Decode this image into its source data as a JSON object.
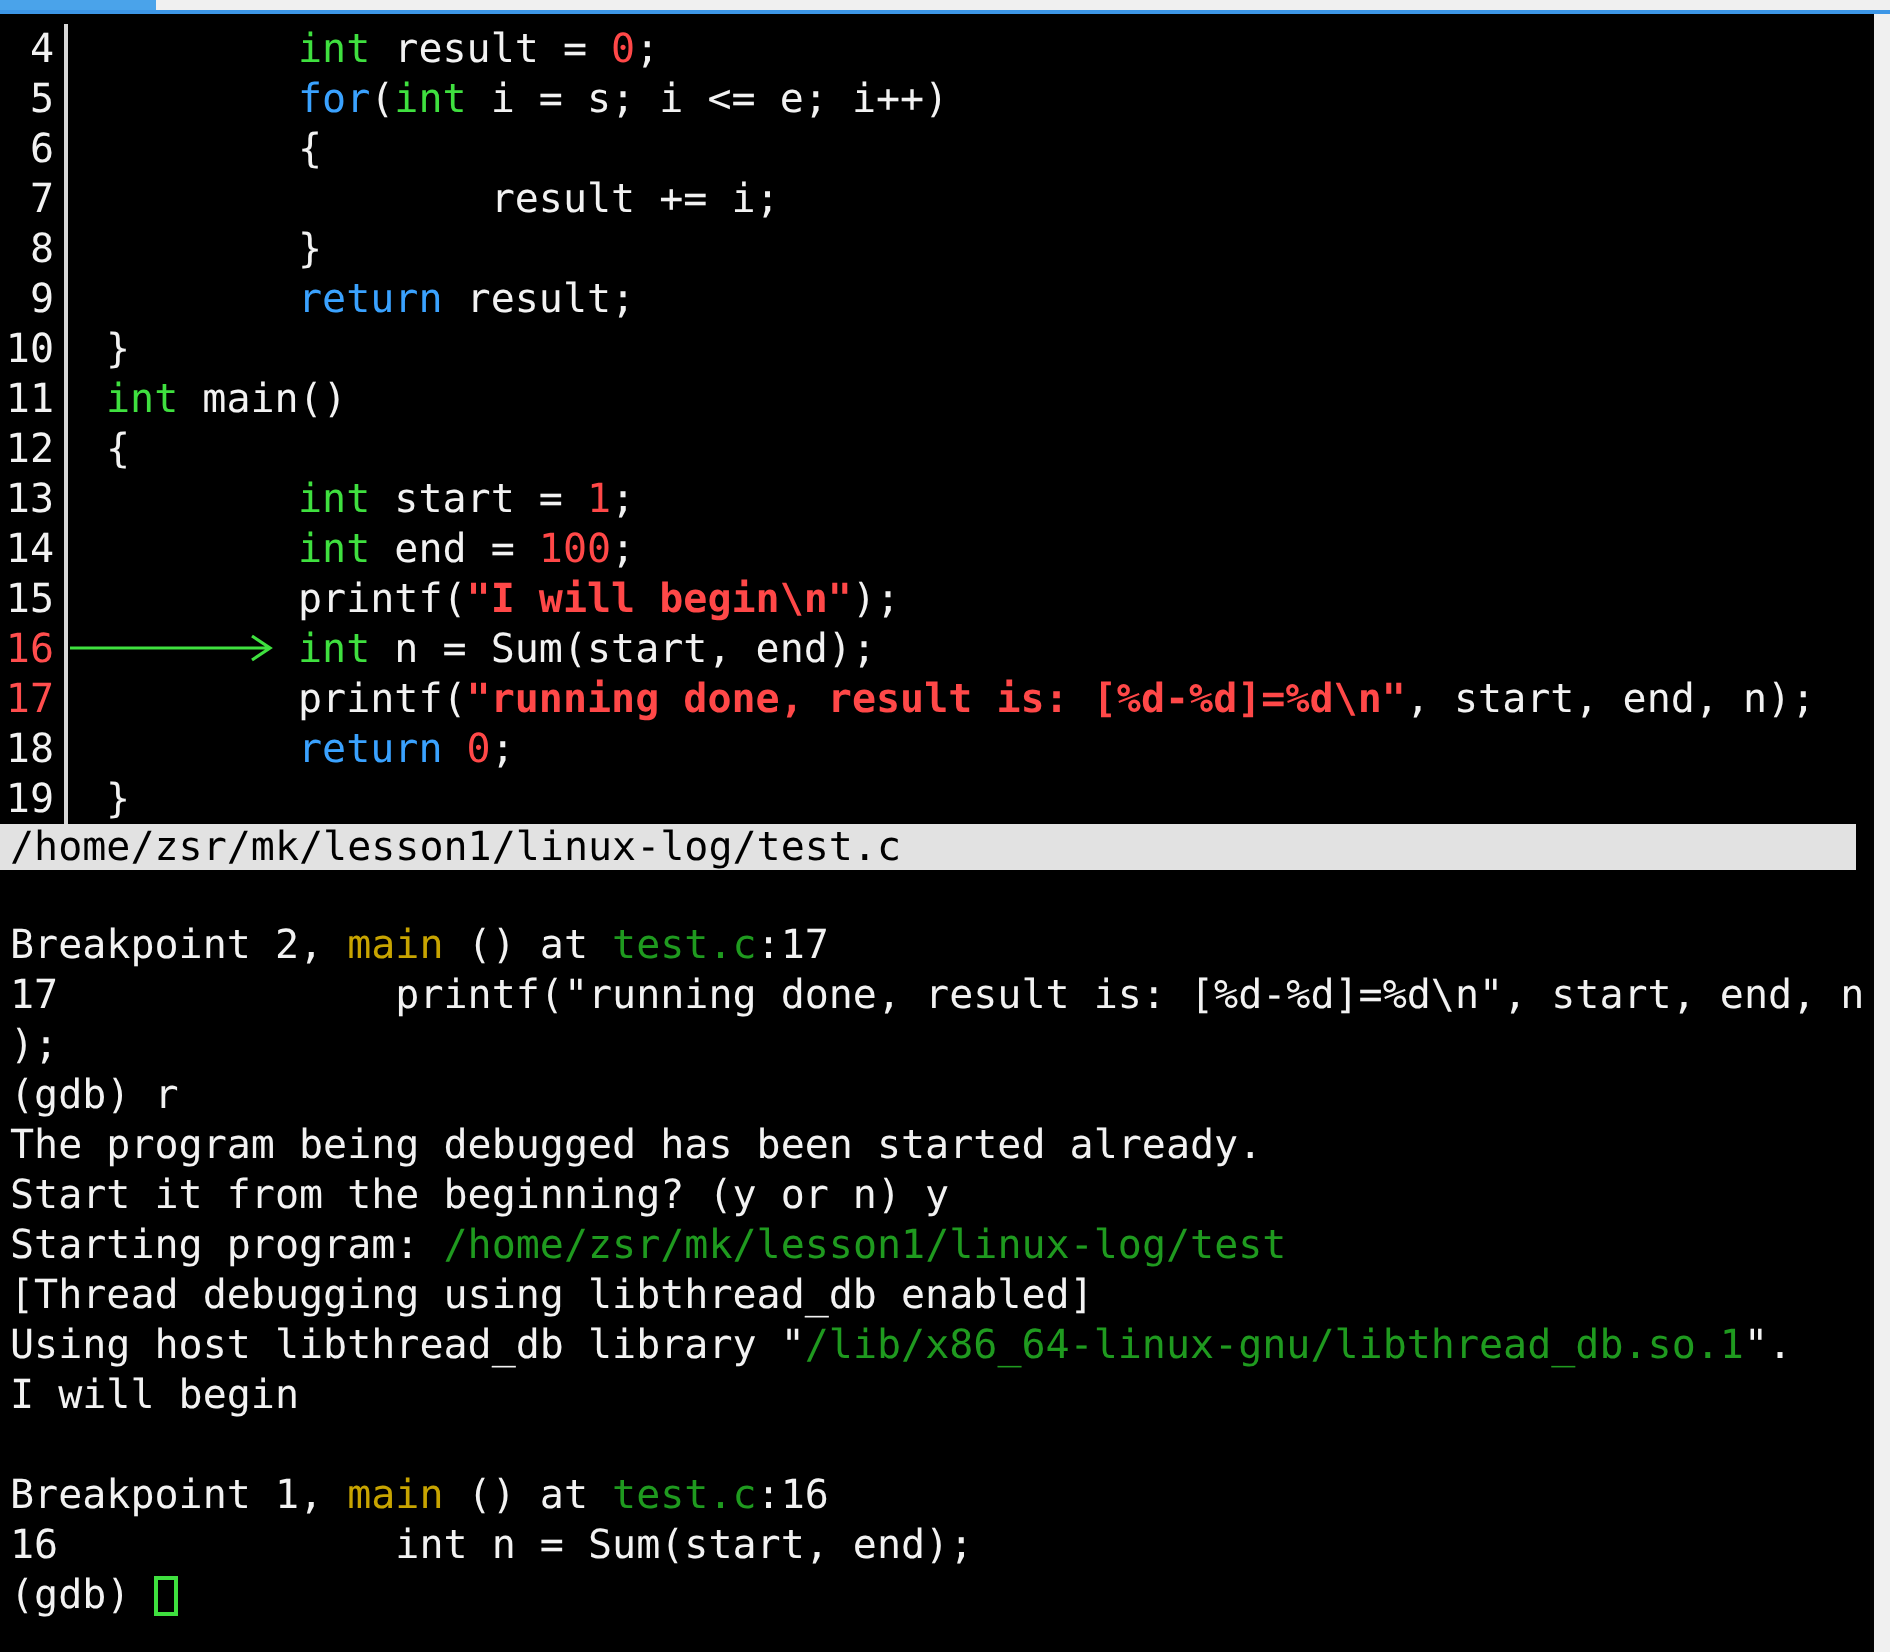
{
  "source": {
    "lines": [
      {
        "number": "4",
        "indented": true,
        "breakpoint": false,
        "current": false,
        "tokens": [
          {
            "text": "int",
            "kind": "type"
          },
          {
            "text": " result = ",
            "kind": "plain"
          },
          {
            "text": "0",
            "kind": "number"
          },
          {
            "text": ";",
            "kind": "plain"
          }
        ]
      },
      {
        "number": "5",
        "indented": true,
        "breakpoint": false,
        "current": false,
        "tokens": [
          {
            "text": "for",
            "kind": "keyword"
          },
          {
            "text": "(",
            "kind": "plain"
          },
          {
            "text": "int",
            "kind": "type"
          },
          {
            "text": " i = s; i <= e; i++)",
            "kind": "plain"
          }
        ]
      },
      {
        "number": "6",
        "indented": true,
        "breakpoint": false,
        "current": false,
        "tokens": [
          {
            "text": "{",
            "kind": "plain"
          }
        ]
      },
      {
        "number": "7",
        "indented": true,
        "breakpoint": false,
        "current": false,
        "tokens": [
          {
            "text": "\tresult += i;",
            "kind": "plain"
          }
        ]
      },
      {
        "number": "8",
        "indented": true,
        "breakpoint": false,
        "current": false,
        "tokens": [
          {
            "text": "}",
            "kind": "plain"
          }
        ]
      },
      {
        "number": "9",
        "indented": true,
        "breakpoint": false,
        "current": false,
        "tokens": [
          {
            "text": "return",
            "kind": "keyword"
          },
          {
            "text": " result;",
            "kind": "plain"
          }
        ]
      },
      {
        "number": "10",
        "indented": false,
        "breakpoint": false,
        "current": false,
        "tokens": [
          {
            "text": "}",
            "kind": "plain"
          }
        ]
      },
      {
        "number": "11",
        "indented": false,
        "breakpoint": false,
        "current": false,
        "tokens": [
          {
            "text": "int",
            "kind": "type"
          },
          {
            "text": " main()",
            "kind": "plain"
          }
        ]
      },
      {
        "number": "12",
        "indented": false,
        "breakpoint": false,
        "current": false,
        "tokens": [
          {
            "text": "{",
            "kind": "plain"
          }
        ]
      },
      {
        "number": "13",
        "indented": true,
        "breakpoint": false,
        "current": false,
        "tokens": [
          {
            "text": "int",
            "kind": "type"
          },
          {
            "text": " start = ",
            "kind": "plain"
          },
          {
            "text": "1",
            "kind": "number"
          },
          {
            "text": ";",
            "kind": "plain"
          }
        ]
      },
      {
        "number": "14",
        "indented": true,
        "breakpoint": false,
        "current": false,
        "tokens": [
          {
            "text": "int",
            "kind": "type"
          },
          {
            "text": " end = ",
            "kind": "plain"
          },
          {
            "text": "100",
            "kind": "number"
          },
          {
            "text": ";",
            "kind": "plain"
          }
        ]
      },
      {
        "number": "15",
        "indented": true,
        "breakpoint": false,
        "current": false,
        "tokens": [
          {
            "text": "printf(",
            "kind": "plain"
          },
          {
            "text": "\"I will begin\\n\"",
            "kind": "string"
          },
          {
            "text": ");",
            "kind": "plain"
          }
        ]
      },
      {
        "number": "16",
        "indented": true,
        "breakpoint": true,
        "current": true,
        "tokens": [
          {
            "text": "int",
            "kind": "type"
          },
          {
            "text": " n = Sum(start, end);",
            "kind": "plain"
          }
        ]
      },
      {
        "number": "17",
        "indented": true,
        "breakpoint": true,
        "current": false,
        "tokens": [
          {
            "text": "printf(",
            "kind": "plain"
          },
          {
            "text": "\"running done, result is: [%d-%d]=%d\\n\"",
            "kind": "string"
          },
          {
            "text": ", start, end, n);",
            "kind": "plain"
          }
        ]
      },
      {
        "number": "18",
        "indented": true,
        "breakpoint": false,
        "current": false,
        "tokens": [
          {
            "text": "return",
            "kind": "keyword"
          },
          {
            "text": " 0",
            "kind": "number"
          },
          {
            "text": ";",
            "kind": "plain"
          }
        ]
      },
      {
        "number": "19",
        "indented": false,
        "breakpoint": false,
        "current": false,
        "tokens": [
          {
            "text": "}",
            "kind": "plain"
          }
        ]
      }
    ]
  },
  "status_bar": {
    "path": "/home/zsr/mk/lesson1/linux-log/test.c"
  },
  "console": {
    "lines": [
      {
        "gap_before": true,
        "segments": [
          {
            "text": "Breakpoint 2, ",
            "kind": "plain"
          },
          {
            "text": "main",
            "kind": "function"
          },
          {
            "text": " () at ",
            "kind": "plain"
          },
          {
            "text": "test.c",
            "kind": "file"
          },
          {
            "text": ":17",
            "kind": "plain"
          }
        ]
      },
      {
        "segments": [
          {
            "text": "17\t\tprintf(\"running done, result is: [%d-%d]=%d\\n\", start, end, n",
            "kind": "plain"
          }
        ]
      },
      {
        "segments": [
          {
            "text": ");",
            "kind": "plain"
          }
        ]
      },
      {
        "segments": [
          {
            "text": "(gdb) r",
            "kind": "plain"
          }
        ]
      },
      {
        "segments": [
          {
            "text": "The program being debugged has been started already.",
            "kind": "plain"
          }
        ]
      },
      {
        "segments": [
          {
            "text": "Start it from the beginning? (y or n) y",
            "kind": "plain"
          }
        ]
      },
      {
        "segments": [
          {
            "text": "Starting program: ",
            "kind": "plain"
          },
          {
            "text": "/home/zsr/mk/lesson1/linux-log/test",
            "kind": "file"
          }
        ]
      },
      {
        "segments": [
          {
            "text": "[Thread debugging using libthread_db enabled]",
            "kind": "plain"
          }
        ]
      },
      {
        "segments": [
          {
            "text": "Using host libthread_db library \"",
            "kind": "plain"
          },
          {
            "text": "/lib/x86_64-linux-gnu/libthread_db.so.1",
            "kind": "file"
          },
          {
            "text": "\".",
            "kind": "plain"
          }
        ]
      },
      {
        "segments": [
          {
            "text": "I will begin",
            "kind": "plain"
          }
        ]
      },
      {
        "gap_before": true,
        "segments": [
          {
            "text": "Breakpoint 1, ",
            "kind": "plain"
          },
          {
            "text": "main",
            "kind": "function"
          },
          {
            "text": " () at ",
            "kind": "plain"
          },
          {
            "text": "test.c",
            "kind": "file"
          },
          {
            "text": ":16",
            "kind": "plain"
          }
        ]
      },
      {
        "segments": [
          {
            "text": "16\t\tint n = Sum(start, end);",
            "kind": "plain"
          }
        ]
      },
      {
        "cursor": true,
        "segments": [
          {
            "text": "(gdb) ",
            "kind": "plain"
          }
        ]
      }
    ]
  }
}
